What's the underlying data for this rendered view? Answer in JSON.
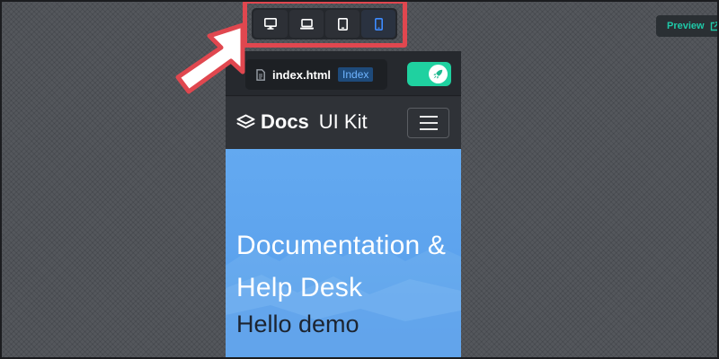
{
  "toolbar": {
    "devices": [
      {
        "name": "desktop",
        "icon": "desktop-icon",
        "active": false
      },
      {
        "name": "laptop",
        "icon": "laptop-icon",
        "active": false
      },
      {
        "name": "tablet",
        "icon": "tablet-icon",
        "active": false
      },
      {
        "name": "mobile",
        "icon": "mobile-icon",
        "active": true
      }
    ],
    "highlight_color": "#e0474f",
    "active_color": "#3d8bff"
  },
  "preview_button": {
    "label": "Preview",
    "icon": "external-link-icon",
    "color": "#1fc9a8"
  },
  "file_bar": {
    "file_icon": "file-icon",
    "file_name": "index.html",
    "badge": "Index",
    "deploy_icon": "rocket-icon",
    "toggle_color": "#1fd1a0"
  },
  "site": {
    "brand_icon": "layers-icon",
    "brand_bold": "Docs",
    "brand_light": "UI Kit",
    "menu_icon": "hamburger-menu-icon",
    "hero_title": "Documentation & Help Desk",
    "hero_subtitle": "Hello demo",
    "hero_color": "#5ea4ee"
  }
}
